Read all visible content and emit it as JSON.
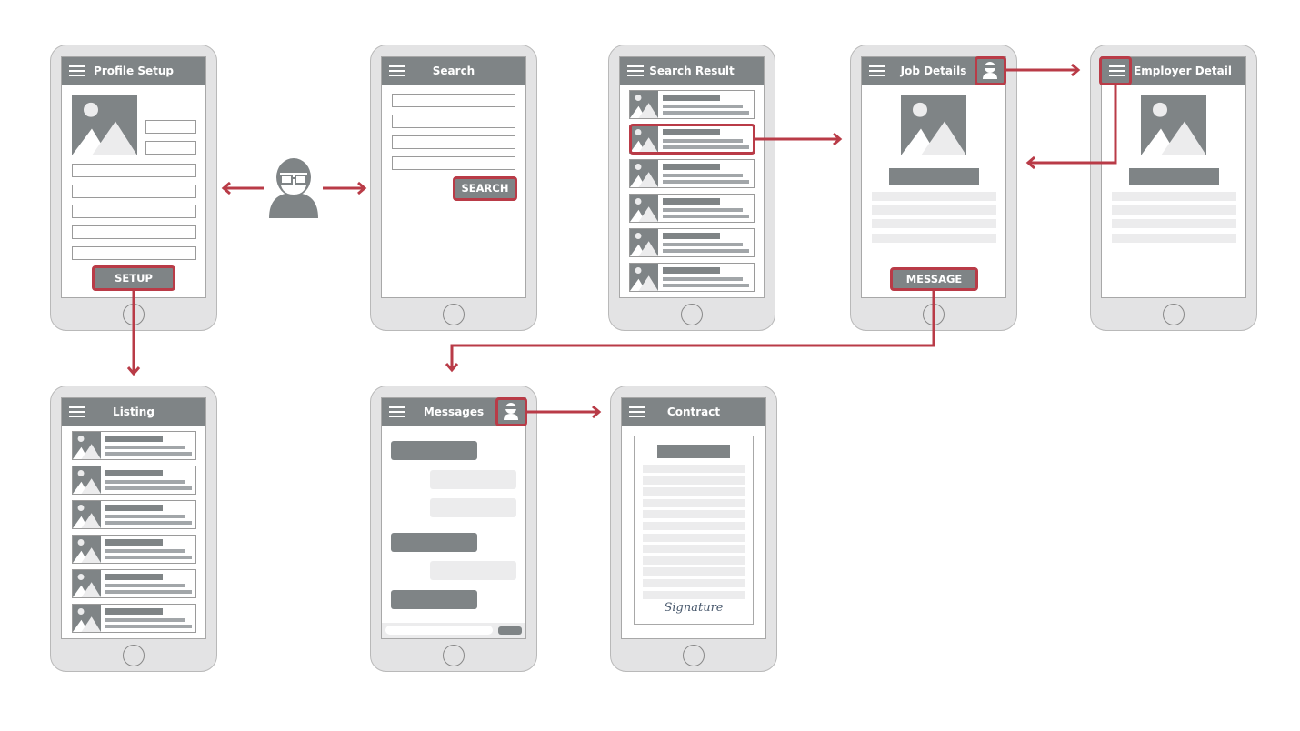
{
  "colors": {
    "accent": "#b93b47",
    "header": "#7f8486",
    "phone": "#e3e3e4",
    "placeholder_light": "#ececed"
  },
  "screens": {
    "profile_setup": {
      "title": "Profile Setup",
      "button": "SETUP"
    },
    "search": {
      "title": "Search",
      "button": "SEARCH"
    },
    "search_result": {
      "title": "Search Result"
    },
    "job_details": {
      "title": "Job Details",
      "button": "MESSAGE"
    },
    "employer_detail": {
      "title": "Employer Detail"
    },
    "listing": {
      "title": "Listing"
    },
    "messages": {
      "title": "Messages"
    },
    "contract": {
      "title": "Contract",
      "signature": "Signature"
    }
  },
  "icons": [
    "menu-icon",
    "image-placeholder-icon",
    "user-avatar-icon",
    "arrow-icon"
  ]
}
